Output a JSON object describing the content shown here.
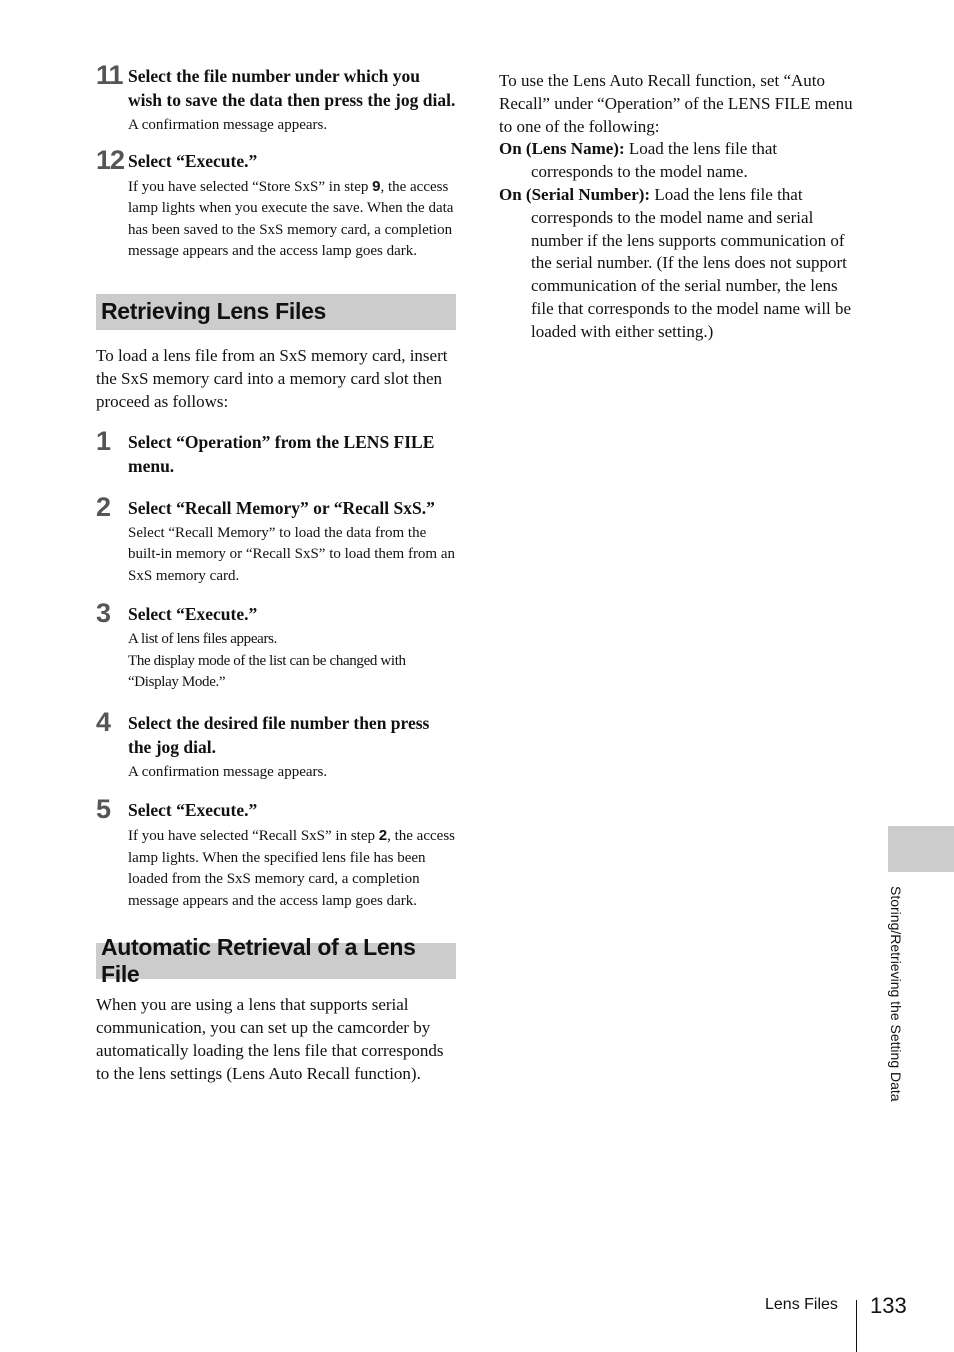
{
  "left_column": {
    "steps_store": [
      {
        "number": "11",
        "title": "Select the file number under which you wish to save the data then press the jog dial.",
        "body": "A confirmation message appears."
      },
      {
        "number": "12",
        "title": "Select “Execute.”",
        "body_pre": "If you have selected “Store SxS” in step ",
        "body_ref": "9",
        "body_post": ", the access lamp lights when you execute the save. When the data has been saved to the SxS memory card, a completion message appears and the access lamp goes dark."
      }
    ],
    "section1": {
      "heading": "Retrieving Lens Files",
      "intro": "To load a lens file from an SxS memory card, insert the SxS memory card into a memory card slot then proceed as follows:",
      "steps": [
        {
          "number": "1",
          "title": "Select “Operation” from the LENS FILE menu."
        },
        {
          "number": "2",
          "title": "Select “Recall Memory” or “Recall SxS.”",
          "body": "Select “Recall Memory” to load the data from the built-in memory or “Recall SxS” to load them from an SxS memory card."
        },
        {
          "number": "3",
          "title": "Select “Execute.”",
          "body_line1": "A list of lens files appears.",
          "body_line2": "The display mode of the list can be changed with “Display Mode.”"
        },
        {
          "number": "4",
          "title": "Select the desired file number then press the jog dial.",
          "body": "A confirmation message appears."
        },
        {
          "number": "5",
          "title": "Select “Execute.”",
          "body_pre": "If you have selected “Recall SxS” in step ",
          "body_ref": "2",
          "body_post": ", the access lamp lights. When the specified lens file has been loaded from the SxS memory card, a completion message appears and the access lamp goes dark."
        }
      ]
    },
    "section2": {
      "heading": "Automatic Retrieval of a Lens File",
      "intro": "When you are using a lens that supports serial communication, you can set up the camcorder by automatically loading the lens file that corresponds to the lens settings (Lens Auto Recall function)."
    }
  },
  "right_column": {
    "intro": "To use the Lens Auto Recall function, set “Auto Recall” under “Operation” of the LENS FILE menu to one of the following:",
    "options": [
      {
        "term": "On (Lens Name):",
        "description": " Load the lens file that corresponds to the model name."
      },
      {
        "term": "On (Serial Number):",
        "description": " Load the lens file that corresponds to the model name and serial number if the lens supports communication of the serial number. (If the lens does not support communication of the serial number, the lens file that corresponds to the model name will be loaded with either setting.)"
      }
    ]
  },
  "side_tab": {
    "label": "Storing/Retrieving the Setting Data"
  },
  "footer": {
    "section_label": "Lens Files",
    "page_number": "133"
  }
}
